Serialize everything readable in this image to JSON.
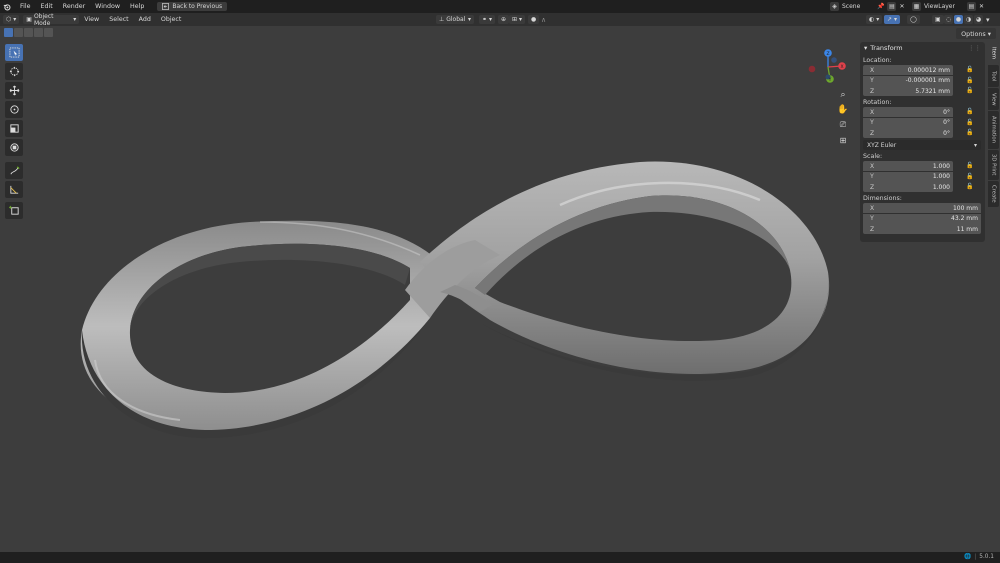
{
  "menubar": {
    "items": [
      "File",
      "Edit",
      "Render",
      "Window",
      "Help"
    ],
    "back_button": "Back to Previous",
    "scene": "Scene",
    "view_layer": "ViewLayer"
  },
  "header": {
    "mode": "Object Mode",
    "menus": [
      "View",
      "Select",
      "Add",
      "Object"
    ],
    "orientation": "Global"
  },
  "viewport": {
    "options_label": "Options",
    "gizmo_axes": {
      "x": "X",
      "y": "Y",
      "z": "Z"
    }
  },
  "npanel": {
    "title": "Transform",
    "location_label": "Location:",
    "location": [
      {
        "axis": "X",
        "value": "0.000012 mm"
      },
      {
        "axis": "Y",
        "value": "-0.000001 mm"
      },
      {
        "axis": "Z",
        "value": "5.7321 mm"
      }
    ],
    "rotation_label": "Rotation:",
    "rotation": [
      {
        "axis": "X",
        "value": "0°"
      },
      {
        "axis": "Y",
        "value": "0°"
      },
      {
        "axis": "Z",
        "value": "0°"
      }
    ],
    "rotation_mode": "XYZ Euler",
    "scale_label": "Scale:",
    "scale": [
      {
        "axis": "X",
        "value": "1.000"
      },
      {
        "axis": "Y",
        "value": "1.000"
      },
      {
        "axis": "Z",
        "value": "1.000"
      }
    ],
    "dimensions_label": "Dimensions:",
    "dimensions": [
      {
        "axis": "X",
        "value": "100 mm"
      },
      {
        "axis": "Y",
        "value": "43.2 mm"
      },
      {
        "axis": "Z",
        "value": "11 mm"
      }
    ]
  },
  "side_tabs": [
    "Item",
    "Tool",
    "View",
    "Animation",
    "3D Print",
    "Create"
  ],
  "statusbar": {
    "version": "5.0.1"
  },
  "colors": {
    "accent": "#4772b3",
    "viewport_bg": "#3d3d3d",
    "axis_x": "#e0414b",
    "axis_y": "#6ea82d",
    "axis_z": "#3b86e8"
  }
}
